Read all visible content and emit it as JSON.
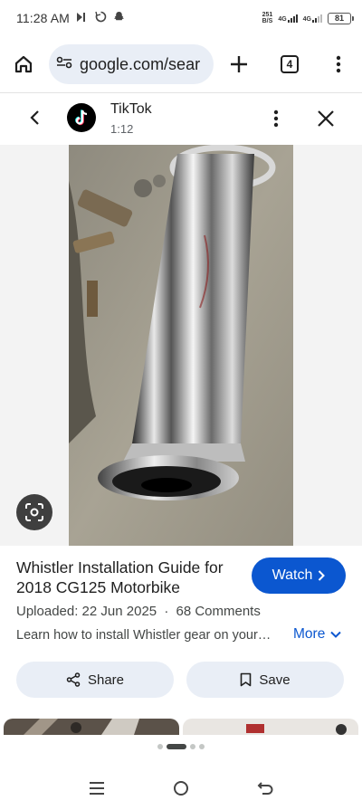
{
  "status": {
    "time": "11:28 AM",
    "speed_value": "251",
    "speed_unit": "B/S",
    "net1": "4G",
    "net2": "4G",
    "battery": "81"
  },
  "browser": {
    "url": "google.com/sear",
    "tab_count": "4"
  },
  "video_header": {
    "source": "TikTok",
    "duration": "1:12"
  },
  "result": {
    "title": "Whistler Installation Guide for 2018 CG125 Motorbike",
    "watch_label": "Watch",
    "uploaded": "Uploaded: 22 Jun 2025",
    "separator": "·",
    "comments": "68 Comments",
    "description": "Learn how to install Whistler gear on your…",
    "more_label": "More",
    "share_label": "Share",
    "save_label": "Save"
  },
  "colors": {
    "accent": "#0b57d0",
    "pill_bg": "#e9eef6"
  },
  "icons": [
    "home-icon",
    "site-settings-icon",
    "plus-icon",
    "tab-switcher-icon",
    "more-vert-icon",
    "back-arrow-icon",
    "tiktok-logo-icon",
    "close-icon",
    "lens-icon",
    "chevron-right-icon",
    "chevron-down-icon",
    "share-icon",
    "bookmark-icon",
    "recents-icon",
    "home-circle-icon",
    "back-gesture-icon"
  ]
}
